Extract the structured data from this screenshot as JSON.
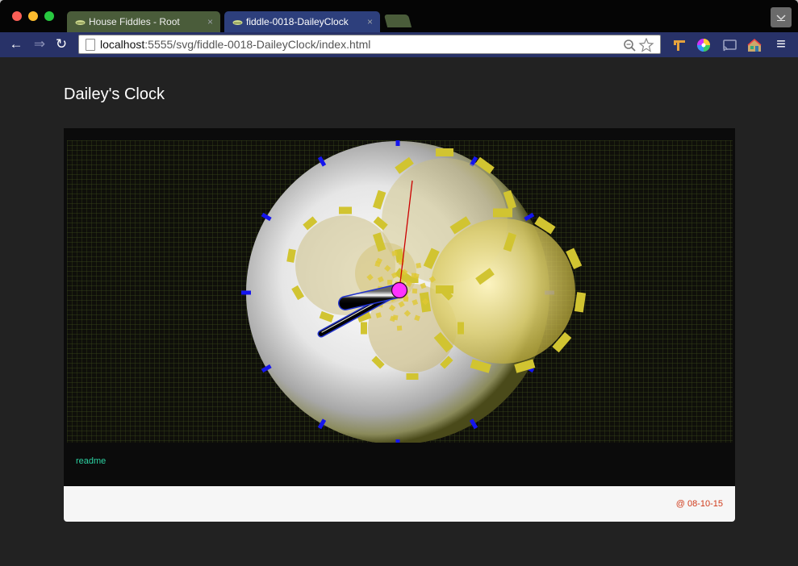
{
  "browser": {
    "tabs": [
      {
        "title": "House Fiddles - Root",
        "close": "×"
      },
      {
        "title": "fiddle-0018-DaileyClock",
        "close": "×"
      }
    ],
    "url_host": "localhost",
    "url_path": ":5555/svg/fiddle-0018-DaileyClock/index.html",
    "nav": {
      "back": "←",
      "forward": "⇒",
      "reload": "↻",
      "menu": "≡"
    },
    "search_icon": "magnifier-icon",
    "star_icon": "star-icon"
  },
  "page": {
    "title": "Dailey's Clock",
    "readme_link": "readme",
    "footer_date": "@ 08-10-15"
  },
  "colors": {
    "accent_link": "#2cd2a2",
    "date_text": "#d03a1a",
    "hour_hand_outline": "#2233cc",
    "second_hand": "#cc0000",
    "center_pin": "#ff33ff",
    "tick": "#0000ff"
  }
}
